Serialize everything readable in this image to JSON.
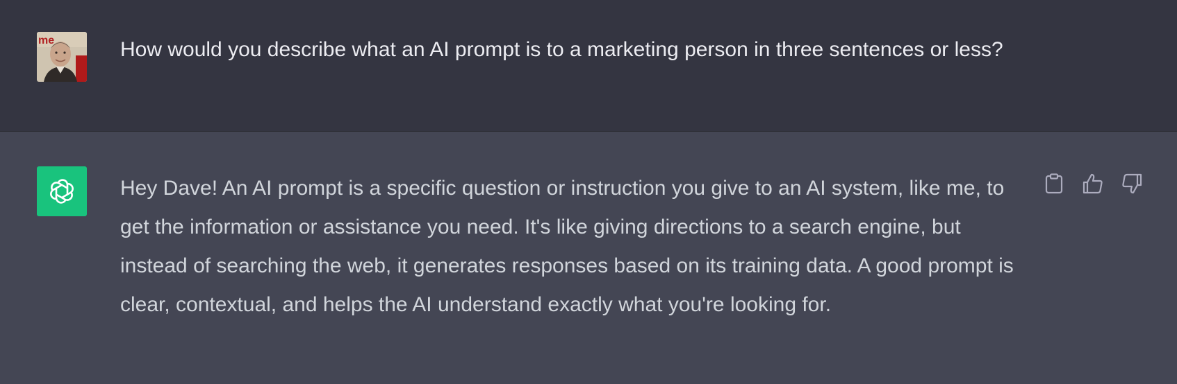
{
  "conversation": {
    "user_message": {
      "text": "How would you describe what an AI prompt is to a marketing person in three sentences or less?"
    },
    "assistant_message": {
      "text": "Hey Dave! An AI prompt is a specific question or instruction you give to an AI system, like me, to get the information or assistance you need. It's like giving directions to a search engine, but instead of searching the web, it generates responses based on its training data. A good prompt is clear, contextual, and helps the AI understand exactly what you're looking for."
    }
  },
  "icons": {
    "user_avatar": "user-photo-avatar",
    "bot_avatar": "openai-logo-icon",
    "copy": "clipboard-icon",
    "like": "thumbs-up-icon",
    "dislike": "thumbs-down-icon"
  },
  "colors": {
    "user_bg": "#343541",
    "assistant_bg": "#444654",
    "bot_avatar_bg": "#19c37d",
    "user_text": "#ececf1",
    "assistant_text": "#d1d5db",
    "icon": "#acacbe"
  }
}
